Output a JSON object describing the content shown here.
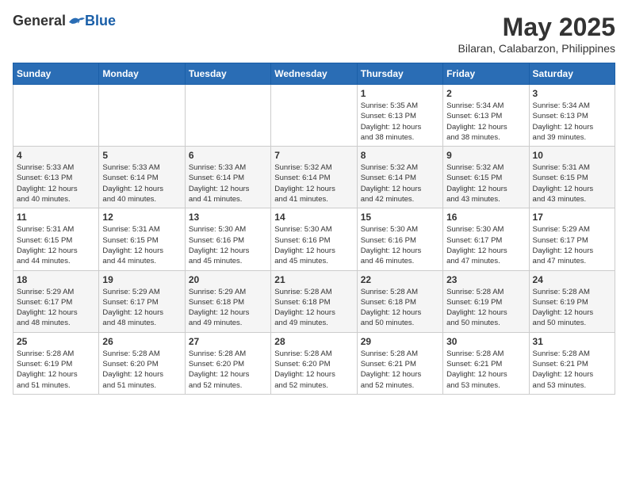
{
  "header": {
    "logo_general": "General",
    "logo_blue": "Blue",
    "month_title": "May 2025",
    "location": "Bilaran, Calabarzon, Philippines"
  },
  "weekdays": [
    "Sunday",
    "Monday",
    "Tuesday",
    "Wednesday",
    "Thursday",
    "Friday",
    "Saturday"
  ],
  "weeks": [
    [
      {
        "day": "",
        "info": ""
      },
      {
        "day": "",
        "info": ""
      },
      {
        "day": "",
        "info": ""
      },
      {
        "day": "",
        "info": ""
      },
      {
        "day": "1",
        "info": "Sunrise: 5:35 AM\nSunset: 6:13 PM\nDaylight: 12 hours\nand 38 minutes."
      },
      {
        "day": "2",
        "info": "Sunrise: 5:34 AM\nSunset: 6:13 PM\nDaylight: 12 hours\nand 38 minutes."
      },
      {
        "day": "3",
        "info": "Sunrise: 5:34 AM\nSunset: 6:13 PM\nDaylight: 12 hours\nand 39 minutes."
      }
    ],
    [
      {
        "day": "4",
        "info": "Sunrise: 5:33 AM\nSunset: 6:13 PM\nDaylight: 12 hours\nand 40 minutes."
      },
      {
        "day": "5",
        "info": "Sunrise: 5:33 AM\nSunset: 6:14 PM\nDaylight: 12 hours\nand 40 minutes."
      },
      {
        "day": "6",
        "info": "Sunrise: 5:33 AM\nSunset: 6:14 PM\nDaylight: 12 hours\nand 41 minutes."
      },
      {
        "day": "7",
        "info": "Sunrise: 5:32 AM\nSunset: 6:14 PM\nDaylight: 12 hours\nand 41 minutes."
      },
      {
        "day": "8",
        "info": "Sunrise: 5:32 AM\nSunset: 6:14 PM\nDaylight: 12 hours\nand 42 minutes."
      },
      {
        "day": "9",
        "info": "Sunrise: 5:32 AM\nSunset: 6:15 PM\nDaylight: 12 hours\nand 43 minutes."
      },
      {
        "day": "10",
        "info": "Sunrise: 5:31 AM\nSunset: 6:15 PM\nDaylight: 12 hours\nand 43 minutes."
      }
    ],
    [
      {
        "day": "11",
        "info": "Sunrise: 5:31 AM\nSunset: 6:15 PM\nDaylight: 12 hours\nand 44 minutes."
      },
      {
        "day": "12",
        "info": "Sunrise: 5:31 AM\nSunset: 6:15 PM\nDaylight: 12 hours\nand 44 minutes."
      },
      {
        "day": "13",
        "info": "Sunrise: 5:30 AM\nSunset: 6:16 PM\nDaylight: 12 hours\nand 45 minutes."
      },
      {
        "day": "14",
        "info": "Sunrise: 5:30 AM\nSunset: 6:16 PM\nDaylight: 12 hours\nand 45 minutes."
      },
      {
        "day": "15",
        "info": "Sunrise: 5:30 AM\nSunset: 6:16 PM\nDaylight: 12 hours\nand 46 minutes."
      },
      {
        "day": "16",
        "info": "Sunrise: 5:30 AM\nSunset: 6:17 PM\nDaylight: 12 hours\nand 47 minutes."
      },
      {
        "day": "17",
        "info": "Sunrise: 5:29 AM\nSunset: 6:17 PM\nDaylight: 12 hours\nand 47 minutes."
      }
    ],
    [
      {
        "day": "18",
        "info": "Sunrise: 5:29 AM\nSunset: 6:17 PM\nDaylight: 12 hours\nand 48 minutes."
      },
      {
        "day": "19",
        "info": "Sunrise: 5:29 AM\nSunset: 6:17 PM\nDaylight: 12 hours\nand 48 minutes."
      },
      {
        "day": "20",
        "info": "Sunrise: 5:29 AM\nSunset: 6:18 PM\nDaylight: 12 hours\nand 49 minutes."
      },
      {
        "day": "21",
        "info": "Sunrise: 5:28 AM\nSunset: 6:18 PM\nDaylight: 12 hours\nand 49 minutes."
      },
      {
        "day": "22",
        "info": "Sunrise: 5:28 AM\nSunset: 6:18 PM\nDaylight: 12 hours\nand 50 minutes."
      },
      {
        "day": "23",
        "info": "Sunrise: 5:28 AM\nSunset: 6:19 PM\nDaylight: 12 hours\nand 50 minutes."
      },
      {
        "day": "24",
        "info": "Sunrise: 5:28 AM\nSunset: 6:19 PM\nDaylight: 12 hours\nand 50 minutes."
      }
    ],
    [
      {
        "day": "25",
        "info": "Sunrise: 5:28 AM\nSunset: 6:19 PM\nDaylight: 12 hours\nand 51 minutes."
      },
      {
        "day": "26",
        "info": "Sunrise: 5:28 AM\nSunset: 6:20 PM\nDaylight: 12 hours\nand 51 minutes."
      },
      {
        "day": "27",
        "info": "Sunrise: 5:28 AM\nSunset: 6:20 PM\nDaylight: 12 hours\nand 52 minutes."
      },
      {
        "day": "28",
        "info": "Sunrise: 5:28 AM\nSunset: 6:20 PM\nDaylight: 12 hours\nand 52 minutes."
      },
      {
        "day": "29",
        "info": "Sunrise: 5:28 AM\nSunset: 6:21 PM\nDaylight: 12 hours\nand 52 minutes."
      },
      {
        "day": "30",
        "info": "Sunrise: 5:28 AM\nSunset: 6:21 PM\nDaylight: 12 hours\nand 53 minutes."
      },
      {
        "day": "31",
        "info": "Sunrise: 5:28 AM\nSunset: 6:21 PM\nDaylight: 12 hours\nand 53 minutes."
      }
    ]
  ]
}
